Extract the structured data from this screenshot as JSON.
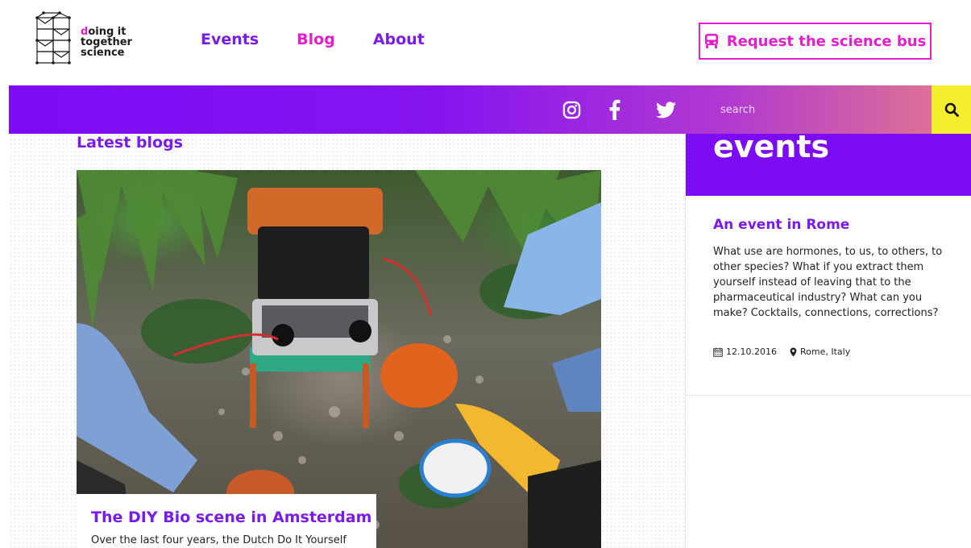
{
  "logo": {
    "line1_accent": "d",
    "line1_rest": "oing it",
    "line2": "together",
    "line3": "science"
  },
  "nav": {
    "items": [
      {
        "label": "Events"
      },
      {
        "label": "Blog"
      },
      {
        "label": "About"
      }
    ]
  },
  "header": {
    "request_button": "Request the science bus",
    "request_icon": "bus-icon"
  },
  "bar": {
    "social_icons": [
      "instagram-icon",
      "facebook-icon",
      "twitter-icon"
    ],
    "search_placeholder": "search",
    "search_icon": "search-icon"
  },
  "blog": {
    "heading": "Latest blogs",
    "post": {
      "title": "The DIY Bio scene in Amsterdam",
      "excerpt": "Over the last four years, the Dutch Do It Yourself"
    }
  },
  "events": {
    "heading": "events",
    "item": {
      "title": "An event in Rome",
      "description": "What use are hormones, to us, to others, to other species? What if you extract them yourself instead of leaving that to the pharmaceutical industry? What can you make? Cocktails, connections, corrections?",
      "date": "12.10.2016",
      "location": "Rome, Italy"
    }
  },
  "colors": {
    "purple": "#7a1be9",
    "magenta": "#e21ed0",
    "yellow": "#f4ee2e"
  }
}
